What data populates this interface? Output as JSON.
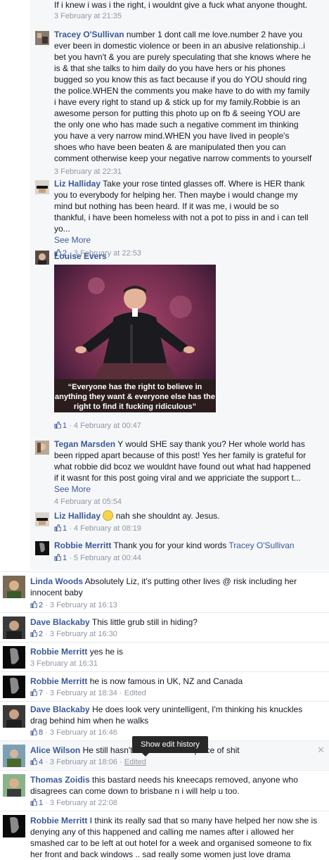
{
  "comments": [
    {
      "text": "If i knew i was i the right, i wouldnt give a fuck what anyone thought.",
      "time": "3 February at 21:35"
    },
    {
      "author": "Tracey O'Sullivan",
      "text": "number 1 dont call me love.number 2 have you ever been in domestic violence or been in an abusive relationship..i bet you havn't & you are purely speculating that she knows where he is & that she talks to him daily do you have hers or his phones bugged so you know this as fact because if you do YOU should ring the police.WHEN the comments you make have to do with my family i have every right to stand up & stick up for my family.Robbie is an awesome person for putting this photo up on fb & seeing YOU are the only one who has made such a negative comment im thinking you have a very narrow mind.WHEN you have lived in people's shoes who have been beaten & are manipulated then you can comment otherwise keep your negative narrow comments to yourself",
      "time": "3 February at 22:31"
    },
    {
      "author": "Liz Halliday",
      "text": "Take your rose tinted glasses off. Where is HER thank you to everybody for helping her. Then maybe i would change my mind but nothing has been heard. If it was me, i would be so thankful, i have been homeless with not a pot to piss in and i can tell yo...",
      "see_more": "See More",
      "likes": "2",
      "time": "3 February at 22:53"
    },
    {
      "author": "Louise Evers",
      "photo_caption": "“Everyone has the right to believe in anything they want & everyone else has the right to find it fucking ridiculous”",
      "likes": "1",
      "time": "4 February at 00:47"
    },
    {
      "author": "Tegan Marsden",
      "text": "Y would SHE say thank you? Her whole world has been ripped apart because of this post! Yes her family is grateful for what robbie did bcoz we wouldnt have found out what had happened if it wasnt for this post going viral and we appriciate the support t...",
      "see_more": "See More",
      "time": "4 February at 05:54"
    },
    {
      "author": "Liz Halliday",
      "text": "nah she shouldnt ay. Jesus.",
      "likes": "1",
      "time": "4 February at 08:19"
    },
    {
      "author": "Robbie Merritt",
      "text": "Thank you for your kind words",
      "mention": "Tracey O'Sullivan",
      "likes": "1",
      "time": "5 February at 00:44"
    },
    {
      "author": "Linda Woods",
      "text": "Absolutely Liz, it's putting other lives @ risk including her innocent baby",
      "likes": "2",
      "time": "3 February at 16:13"
    },
    {
      "author": "Dave Blackaby",
      "text": "This little grub still in hiding?",
      "likes": "2",
      "time": "3 February at 16:30"
    },
    {
      "author": "Robbie Merritt",
      "text": "yes he is",
      "time": "3 February at 16:31"
    },
    {
      "author": "Robbie Merritt",
      "text": "he is now famous in UK, NZ and Canada",
      "likes": "7",
      "time": "3 February at 18:34",
      "edited": "Edited"
    },
    {
      "author": "Dave Blackaby",
      "text": "He does look very unintelligent, I'm thinking his knuckles drag behind him when he walks",
      "likes": "8",
      "time": "3 February at 16:46"
    },
    {
      "author": "Alice Wilson",
      "text_before": "He still hasn't",
      "text_after": "a piece of shit",
      "likes": "4",
      "time": "3 February at 18:06",
      "edited": "Edited"
    },
    {
      "author": "Thomas Zoidis",
      "text": "this bastard needs his kneecaps removed, anyone who disagrees can come down to brisbane n i will help u too.",
      "likes": "1",
      "time": "3 February at 22:08"
    },
    {
      "author": "Robbie Merritt",
      "text": "I think its really sad that so many have helped her now she is denying any of this happened and calling me names after i allowed her smashed car to be left at out hotel for a week and organised someone to fix her front and back windows .. sad really some women just love drama"
    }
  ],
  "tooltip": "Show edit history",
  "separator": "·",
  "colors": {
    "link": "#3b5998",
    "meta": "#9197a3",
    "nested_bg": "#f6f7f9"
  }
}
